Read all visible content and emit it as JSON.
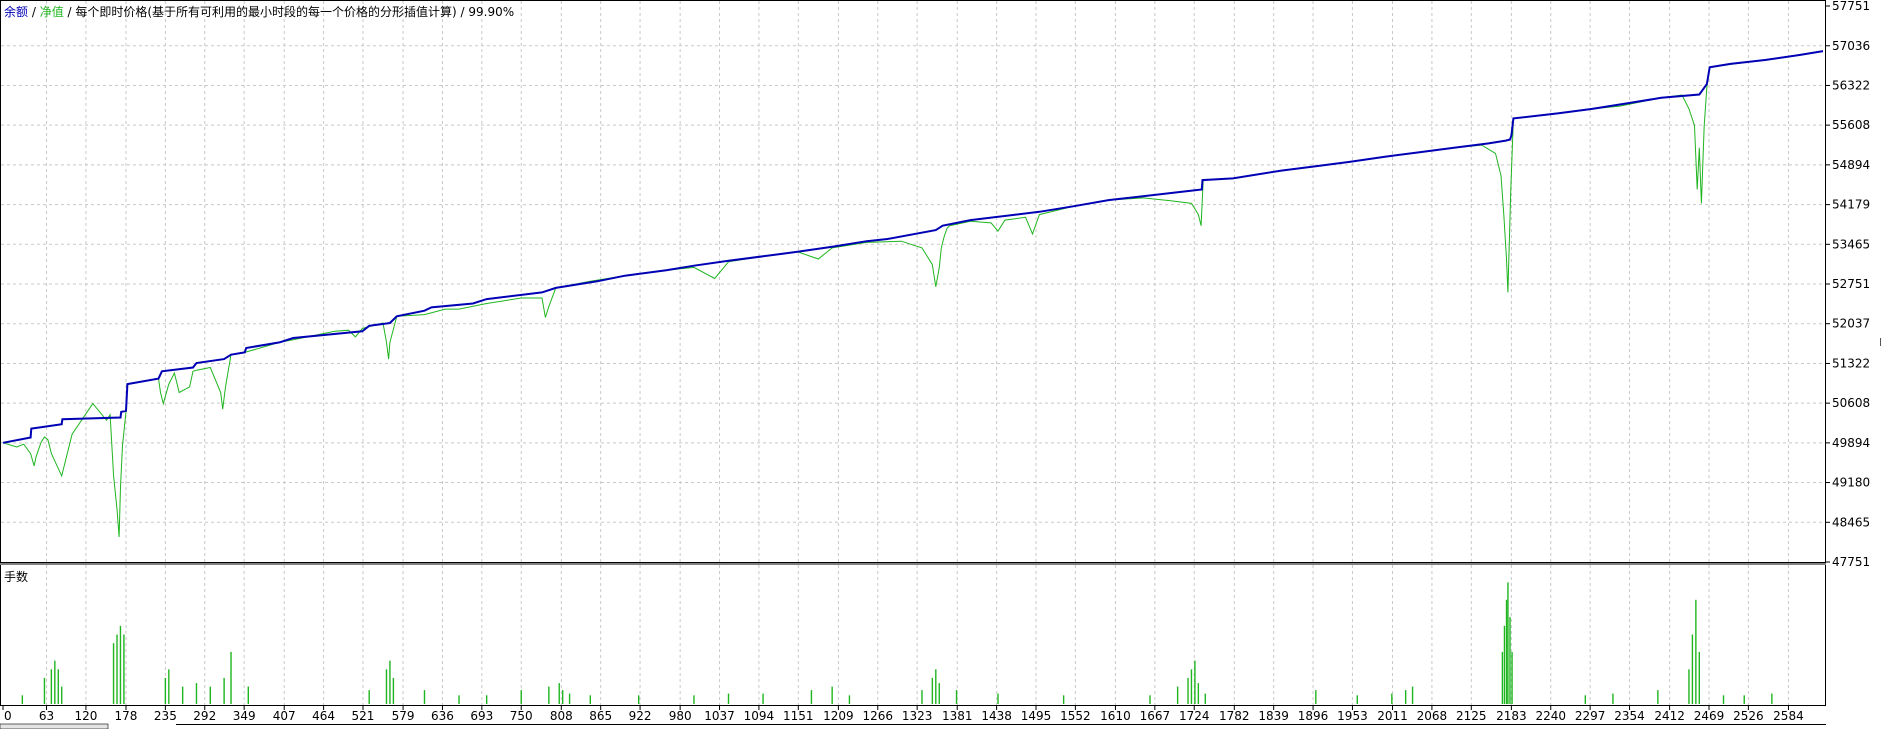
{
  "header": {
    "balance_label": "余额",
    "sep1": " / ",
    "equity_label": "净值",
    "description": " / 每个即时价格(基于所有可利用的最小时段的每一个价格的分形插值计算) / 99.90%"
  },
  "lots_label": "手数",
  "colors": {
    "balance": "#0000b4",
    "equity": "#1fb51f",
    "lots": "#1fb51f",
    "grid": "#c8c8c8",
    "frame": "#000000",
    "background": "#ffffff"
  },
  "chart_data": [
    {
      "type": "line",
      "title": "",
      "xlabel": "",
      "ylabel": "",
      "ylim": [
        47751,
        57751
      ],
      "y_ticks": [
        57751,
        57036,
        56322,
        55608,
        54894,
        54179,
        53465,
        52751,
        52037,
        51322,
        50608,
        49894,
        49180,
        48465,
        47751
      ],
      "xlim": [
        0,
        2634
      ],
      "x_ticks": [
        0,
        63,
        120,
        178,
        235,
        292,
        349,
        407,
        464,
        521,
        579,
        636,
        693,
        750,
        808,
        865,
        922,
        980,
        1037,
        1094,
        1151,
        1209,
        1266,
        1323,
        1381,
        1438,
        1495,
        1552,
        1610,
        1667,
        1724,
        1782,
        1839,
        1896,
        1953,
        2011,
        2068,
        2125,
        2183,
        2240,
        2297,
        2354,
        2412,
        2469,
        2526,
        2584
      ],
      "grid": true,
      "series": [
        {
          "name": "余额",
          "x": [
            0,
            40,
            41,
            85,
            86,
            170,
            171,
            178,
            180,
            225,
            230,
            275,
            280,
            320,
            330,
            350,
            352,
            400,
            420,
            520,
            530,
            560,
            570,
            610,
            620,
            680,
            700,
            780,
            800,
            860,
            900,
            960,
            1000,
            1050,
            1100,
            1150,
            1200,
            1250,
            1280,
            1350,
            1360,
            1400,
            1500,
            1550,
            1600,
            1700,
            1735,
            1736,
            1780,
            1850,
            1900,
            1950,
            2000,
            2050,
            2100,
            2150,
            2175,
            2181,
            2183,
            2186,
            2250,
            2300,
            2350,
            2400,
            2455,
            2458,
            2466,
            2470,
            2500,
            2550,
            2600,
            2634
          ],
          "y": [
            49894,
            49990,
            50150,
            50230,
            50320,
            50350,
            50450,
            50470,
            50950,
            51050,
            51180,
            51250,
            51330,
            51400,
            51480,
            51520,
            51600,
            51700,
            51780,
            51900,
            52000,
            52050,
            52170,
            52270,
            52330,
            52400,
            52480,
            52600,
            52680,
            52800,
            52900,
            53000,
            53080,
            53170,
            53250,
            53330,
            53420,
            53520,
            53560,
            53720,
            53800,
            53900,
            54050,
            54150,
            54260,
            54400,
            54450,
            54620,
            54650,
            54790,
            54870,
            54950,
            55040,
            55120,
            55200,
            55280,
            55330,
            55350,
            55420,
            55730,
            55820,
            55900,
            56000,
            56100,
            56160,
            56210,
            56350,
            56650,
            56710,
            56780,
            56870,
            56940
          ]
        },
        {
          "name": "净值",
          "x": [
            0,
            20,
            30,
            40,
            45,
            48,
            55,
            60,
            65,
            70,
            85,
            100,
            130,
            150,
            155,
            160,
            165,
            168,
            170,
            173,
            178,
            180,
            200,
            225,
            228,
            232,
            240,
            248,
            255,
            270,
            275,
            280,
            300,
            315,
            318,
            322,
            330,
            350,
            400,
            420,
            480,
            500,
            510,
            520,
            550,
            555,
            558,
            560,
            570,
            610,
            640,
            660,
            700,
            750,
            780,
            785,
            790,
            800,
            850,
            900,
            960,
            1000,
            1030,
            1050,
            1100,
            1150,
            1180,
            1200,
            1250,
            1300,
            1330,
            1345,
            1350,
            1355,
            1358,
            1362,
            1366,
            1370,
            1400,
            1430,
            1440,
            1450,
            1480,
            1490,
            1500,
            1550,
            1600,
            1650,
            1690,
            1720,
            1730,
            1734,
            1737,
            1780,
            1850,
            1900,
            1950,
            2000,
            2050,
            2100,
            2140,
            2160,
            2168,
            2172,
            2176,
            2178,
            2182,
            2186,
            2250,
            2300,
            2340,
            2400,
            2430,
            2440,
            2448,
            2450,
            2452,
            2455,
            2458,
            2462,
            2466,
            2470,
            2500,
            2550,
            2600,
            2634
          ],
          "y": [
            49894,
            49820,
            49870,
            49700,
            49480,
            49650,
            49900,
            50000,
            49950,
            49700,
            49300,
            50050,
            50600,
            50300,
            50400,
            49300,
            48700,
            48200,
            49100,
            49850,
            50450,
            50950,
            51000,
            51050,
            50800,
            50600,
            50950,
            51150,
            50800,
            50900,
            51180,
            51200,
            51250,
            50800,
            50500,
            50900,
            51480,
            51520,
            51700,
            51750,
            51900,
            51920,
            51800,
            51950,
            52050,
            51700,
            51400,
            51700,
            52170,
            52200,
            52300,
            52300,
            52400,
            52500,
            52500,
            52150,
            52350,
            52680,
            52800,
            52900,
            53000,
            53050,
            52850,
            53150,
            53250,
            53330,
            53200,
            53400,
            53500,
            53520,
            53400,
            53100,
            52700,
            53050,
            53400,
            53600,
            53750,
            53800,
            53880,
            53850,
            53700,
            53900,
            53950,
            53650,
            54000,
            54150,
            54260,
            54300,
            54250,
            54200,
            54000,
            53800,
            54620,
            54650,
            54790,
            54870,
            54950,
            55040,
            55120,
            55200,
            55250,
            55100,
            54700,
            54000,
            53200,
            52600,
            54400,
            55730,
            55820,
            55900,
            55950,
            56100,
            56150,
            55900,
            55600,
            55000,
            54450,
            55200,
            54200,
            55600,
            56300,
            56650,
            56700,
            56780,
            56870,
            56940
          ]
        }
      ]
    },
    {
      "type": "bar",
      "title": "手数",
      "xlim": [
        0,
        2634
      ],
      "series": [
        {
          "name": "手数",
          "x": [
            28,
            60,
            70,
            75,
            80,
            85,
            160,
            165,
            170,
            175,
            235,
            240,
            260,
            280,
            300,
            320,
            330,
            355,
            530,
            555,
            560,
            565,
            610,
            660,
            700,
            750,
            790,
            805,
            810,
            820,
            850,
            920,
            1000,
            1050,
            1100,
            1170,
            1200,
            1225,
            1330,
            1345,
            1350,
            1355,
            1380,
            1440,
            1535,
            1660,
            1700,
            1715,
            1720,
            1725,
            1730,
            1740,
            1900,
            1960,
            2010,
            2030,
            2040,
            2170,
            2173,
            2176,
            2178,
            2181,
            2184,
            2290,
            2330,
            2395,
            2440,
            2445,
            2450,
            2455,
            2490,
            2520,
            2560
          ],
          "values": [
            0.05,
            0.15,
            0.2,
            0.25,
            0.2,
            0.1,
            0.35,
            0.4,
            0.45,
            0.4,
            0.15,
            0.2,
            0.1,
            0.12,
            0.1,
            0.15,
            0.3,
            0.1,
            0.08,
            0.2,
            0.25,
            0.15,
            0.08,
            0.05,
            0.05,
            0.08,
            0.1,
            0.12,
            0.08,
            0.06,
            0.05,
            0.05,
            0.05,
            0.06,
            0.06,
            0.08,
            0.1,
            0.05,
            0.08,
            0.15,
            0.2,
            0.12,
            0.08,
            0.06,
            0.05,
            0.05,
            0.1,
            0.15,
            0.2,
            0.25,
            0.12,
            0.06,
            0.08,
            0.05,
            0.06,
            0.08,
            0.1,
            0.3,
            0.45,
            0.6,
            0.7,
            0.5,
            0.3,
            0.05,
            0.06,
            0.08,
            0.2,
            0.4,
            0.6,
            0.3,
            0.05,
            0.05,
            0.06
          ]
        }
      ]
    }
  ]
}
